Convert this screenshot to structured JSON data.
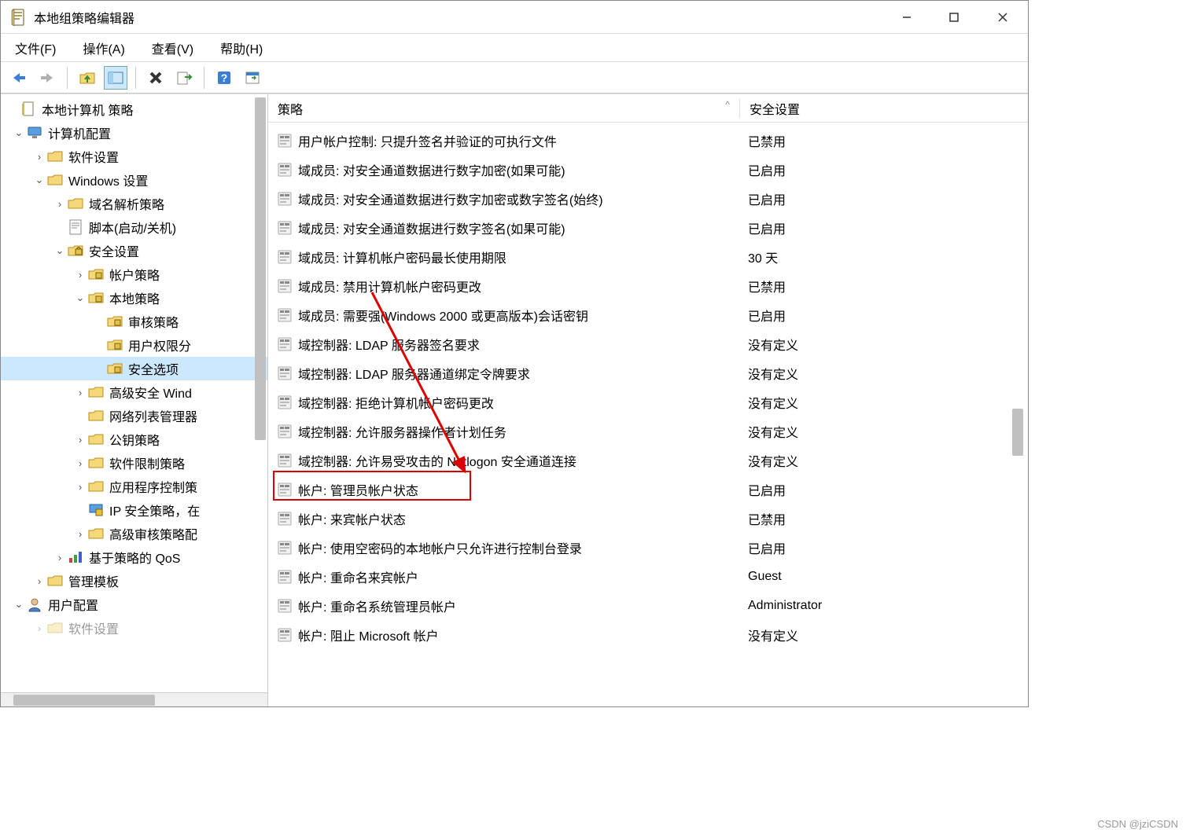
{
  "window": {
    "title": "本地组策略编辑器"
  },
  "menubar": {
    "file": "文件(F)",
    "action": "操作(A)",
    "view": "查看(V)",
    "help": "帮助(H)"
  },
  "tree": {
    "root": "本地计算机 策略",
    "computer_config": "计算机配置",
    "software_settings": "软件设置",
    "windows_settings": "Windows 设置",
    "dns_policy": "域名解析策略",
    "scripts": "脚本(启动/关机)",
    "security_settings": "安全设置",
    "account_policy": "帐户策略",
    "local_policy": "本地策略",
    "audit_policy": "审核策略",
    "user_rights": "用户权限分",
    "security_options": "安全选项",
    "advanced_firewall": "高级安全 Wind",
    "network_list": "网络列表管理器",
    "public_key": "公钥策略",
    "software_restriction": "软件限制策略",
    "app_control": "应用程序控制策",
    "ip_security": "IP 安全策略，在",
    "advanced_audit": "高级审核策略配",
    "policy_qos": "基于策略的 QoS",
    "admin_templates": "管理模板",
    "user_config": "用户配置",
    "user_software": "软件设置"
  },
  "list": {
    "header_policy": "策略",
    "header_setting": "安全设置",
    "rows": [
      {
        "policy": "用户帐户控制: 只提升签名并验证的可执行文件",
        "setting": "已禁用"
      },
      {
        "policy": "域成员: 对安全通道数据进行数字加密(如果可能)",
        "setting": "已启用"
      },
      {
        "policy": "域成员: 对安全通道数据进行数字加密或数字签名(始终)",
        "setting": "已启用"
      },
      {
        "policy": "域成员: 对安全通道数据进行数字签名(如果可能)",
        "setting": "已启用"
      },
      {
        "policy": "域成员: 计算机帐户密码最长使用期限",
        "setting": "30 天"
      },
      {
        "policy": "域成员: 禁用计算机帐户密码更改",
        "setting": "已禁用"
      },
      {
        "policy": "域成员: 需要强(Windows 2000 或更高版本)会话密钥",
        "setting": "已启用"
      },
      {
        "policy": "域控制器: LDAP 服务器签名要求",
        "setting": "没有定义"
      },
      {
        "policy": "域控制器: LDAP 服务器通道绑定令牌要求",
        "setting": "没有定义"
      },
      {
        "policy": "域控制器: 拒绝计算机帐户密码更改",
        "setting": "没有定义"
      },
      {
        "policy": "域控制器: 允许服务器操作者计划任务",
        "setting": "没有定义"
      },
      {
        "policy": "域控制器: 允许易受攻击的 Netlogon 安全通道连接",
        "setting": "没有定义"
      },
      {
        "policy": "帐户: 管理员帐户状态",
        "setting": "已启用"
      },
      {
        "policy": "帐户: 来宾帐户状态",
        "setting": "已禁用"
      },
      {
        "policy": "帐户: 使用空密码的本地帐户只允许进行控制台登录",
        "setting": "已启用"
      },
      {
        "policy": "帐户: 重命名来宾帐户",
        "setting": "Guest"
      },
      {
        "policy": "帐户: 重命名系统管理员帐户",
        "setting": "Administrator"
      },
      {
        "policy": "帐户: 阻止 Microsoft 帐户",
        "setting": "没有定义"
      }
    ]
  },
  "watermark": "CSDN @jziCSDN"
}
